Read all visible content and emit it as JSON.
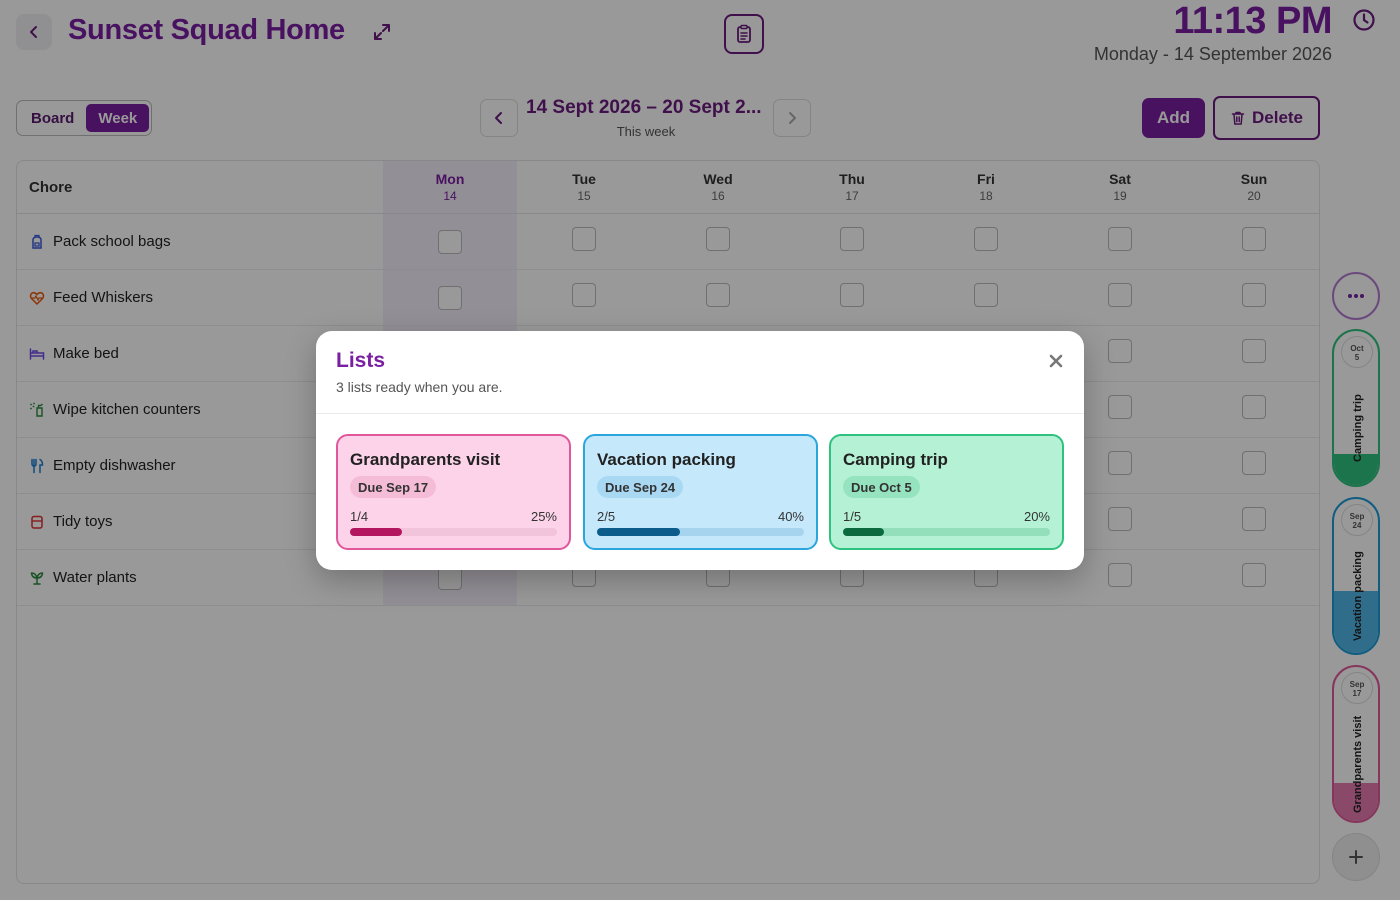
{
  "header": {
    "title": "Sunset Squad Home",
    "time": "11:13 PM",
    "date": "Monday - 14 September 2026"
  },
  "toolbar": {
    "view_board": "Board",
    "view_week": "Week",
    "active_view": "Week",
    "week_range": "14 Sept 2026 – 20 Sept 2...",
    "week_sub": "This week",
    "add_label": "Add",
    "delete_label": "Delete"
  },
  "table": {
    "chore_header": "Chore",
    "days": [
      {
        "name": "Mon",
        "date": "14",
        "today": true
      },
      {
        "name": "Tue",
        "date": "15",
        "today": false
      },
      {
        "name": "Wed",
        "date": "16",
        "today": false
      },
      {
        "name": "Thu",
        "date": "17",
        "today": false
      },
      {
        "name": "Fri",
        "date": "18",
        "today": false
      },
      {
        "name": "Sat",
        "date": "19",
        "today": false
      },
      {
        "name": "Sun",
        "date": "20",
        "today": false
      }
    ],
    "chores": [
      {
        "label": "Pack school bags",
        "icon": "backpack-icon",
        "color": "#3b5bdb"
      },
      {
        "label": "Feed Whiskers",
        "icon": "heart-pulse-icon",
        "color": "#e8590c"
      },
      {
        "label": "Make bed",
        "icon": "bed-icon",
        "color": "#7048e8"
      },
      {
        "label": "Wipe kitchen counters",
        "icon": "spray-bottle-icon",
        "color": "#2b8a3e"
      },
      {
        "label": "Empty dishwasher",
        "icon": "utensils-icon",
        "color": "#1c7ed6"
      },
      {
        "label": "Tidy toys",
        "icon": "toy-box-icon",
        "color": "#e03131"
      },
      {
        "label": "Water plants",
        "icon": "plant-icon",
        "color": "#2b8a3e"
      }
    ]
  },
  "rail": {
    "lists": [
      {
        "name": "Camping trip",
        "badge_month": "Oct",
        "badge_day": "5",
        "fraction": 0.2,
        "border": "#2ec27e",
        "bg": "#ffffff",
        "fill": "#2ec27e"
      },
      {
        "name": "Vacation packing",
        "badge_month": "Sep",
        "badge_day": "24",
        "fraction": 0.4,
        "border": "#1c9bd6",
        "bg": "#ffffff",
        "fill": "#4fb6e8"
      },
      {
        "name": "Grandparents visit",
        "badge_month": "Sep",
        "badge_day": "17",
        "fraction": 0.25,
        "border": "#e05a9a",
        "bg": "#ffffff",
        "fill": "#e67ab0"
      }
    ]
  },
  "modal": {
    "title": "Lists",
    "subtitle": "3 lists ready when you are.",
    "cards": [
      {
        "name": "Grandparents visit",
        "due": "Due Sep 17",
        "count": "1/4",
        "pct": "25%",
        "fraction": 0.25,
        "bg": "#fdd3ea",
        "border": "#e0579c",
        "chip": "#f5bcd8",
        "track": "#f2c4dc",
        "bar": "#b3165f"
      },
      {
        "name": "Vacation packing",
        "due": "Due Sep 24",
        "count": "2/5",
        "pct": "40%",
        "fraction": 0.4,
        "bg": "#c5e8fb",
        "border": "#2aa6dc",
        "chip": "#a9d9f2",
        "track": "#a6d4ee",
        "bar": "#0b5c8a"
      },
      {
        "name": "Camping trip",
        "due": "Due Oct 5",
        "count": "1/5",
        "pct": "20%",
        "fraction": 0.2,
        "bg": "#b5f2d5",
        "border": "#2ec27e",
        "chip": "#95e3bf",
        "track": "#93dfbb",
        "bar": "#0b6b3f"
      }
    ]
  }
}
